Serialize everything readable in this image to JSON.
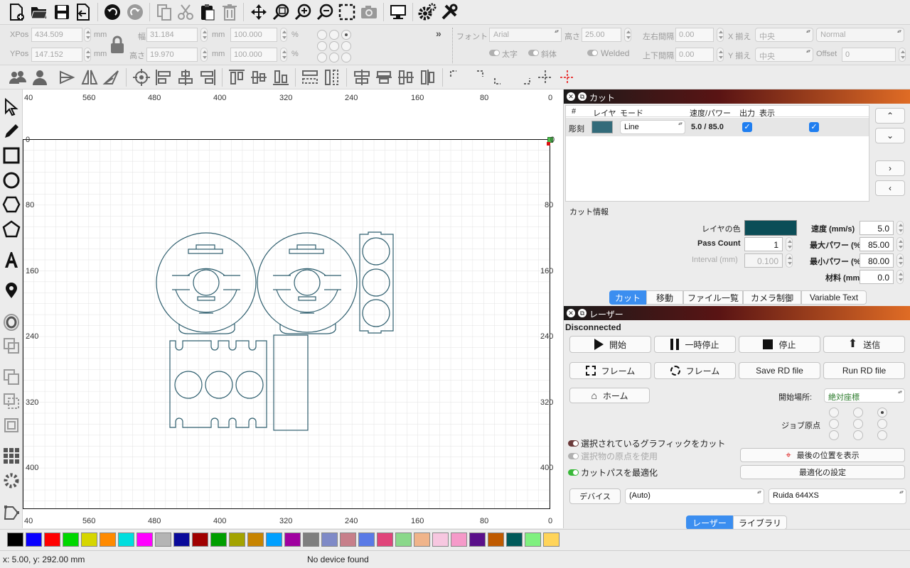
{
  "toolbar1": {
    "icons": [
      "new-file-icon",
      "open-folder-icon",
      "save-icon",
      "export-icon",
      "undo-icon",
      "redo-icon",
      "copy-icon",
      "cut-icon",
      "paste-icon",
      "delete-icon",
      "move-icon",
      "zoom-fit-icon",
      "zoom-in-icon",
      "zoom-out-icon",
      "frame-select-icon",
      "camera-icon",
      "monitor-icon",
      "settings-icon",
      "tools-icon"
    ]
  },
  "props": {
    "xpos_label": "XPos",
    "xpos": "434.509",
    "ypos_label": "YPos",
    "ypos": "147.152",
    "unit": "mm",
    "width_label": "幅",
    "width": "31.184",
    "height_label": "高さ",
    "height": "19.970",
    "scale_x": "100.000",
    "scale_y": "100.000",
    "percent": "%",
    "font_label": "フォント",
    "font": "Arial",
    "font_height_label": "高さ",
    "font_height": "25.00",
    "hspace_label": "左右間隔",
    "hspace": "0.00",
    "vspace_label": "上下間隔",
    "vspace": "0.00",
    "xalign_label": "X 揃え",
    "xalign": "中央",
    "yalign_label": "Y 揃え",
    "yalign": "中央",
    "style": "Normal",
    "offset_label": "Offset",
    "offset": "0",
    "bold": "太字",
    "italic": "斜体",
    "welded": "Welded",
    "more": "»"
  },
  "ruler": {
    "top": [
      "40",
      "560",
      "480",
      "400",
      "320",
      "240",
      "160",
      "80",
      "0"
    ],
    "bottom": [
      "40",
      "560",
      "480",
      "400",
      "320",
      "240",
      "160",
      "80",
      "0"
    ],
    "left": [
      "0",
      "80",
      "160",
      "240",
      "320",
      "400"
    ],
    "right": [
      "0",
      "80",
      "160",
      "240",
      "320",
      "400"
    ]
  },
  "cut_panel": {
    "title": "カット",
    "headers": [
      "#",
      "レイヤ",
      "モード",
      "速度/パワー",
      "出力",
      "表示"
    ],
    "row": {
      "name": "彫刻",
      "color": "#336b7a",
      "mode": "Line",
      "speed_power": "5.0 / 85.0"
    },
    "info_title": "カット情報",
    "layer_color_label": "レイヤの色",
    "layer_color": "#0b4d57",
    "pass_count_label": "Pass Count",
    "pass_count": "1",
    "interval_label": "Interval (mm)",
    "interval": "0.100",
    "speed_label": "速度 (mm/s)",
    "speed": "5.0",
    "max_power_label": "最大パワー (%)",
    "max_power": "85.00",
    "min_power_label": "最小パワー (%)",
    "min_power": "80.00",
    "material_label": "材料 (mm)",
    "material": "0.0",
    "tabs": [
      "カット",
      "移動",
      "ファイル一覧",
      "カメラ制御",
      "Variable Text"
    ]
  },
  "laser_panel": {
    "title": "レーザー",
    "status": "Disconnected",
    "start": "開始",
    "pause": "一時停止",
    "stop": "停止",
    "send": "送信",
    "frame1": "フレーム",
    "frame2": "フレーム",
    "save_rd": "Save RD file",
    "run_rd": "Run RD file",
    "home": "ホーム",
    "start_from_label": "開始場所:",
    "start_from": "絶対座標",
    "job_origin": "ジョブ原点",
    "cut_selected": "選択されているグラフィックをカット",
    "use_origin": "選択物の原点を使用",
    "optimize": "カットパスを最適化",
    "show_last": "最後の位置を表示",
    "optimize_settings": "最適化の設定",
    "device_btn": "デバイス",
    "device": "(Auto)",
    "controller": "Ruida 644XS",
    "tabs": [
      "レーザー",
      "ライブラリ"
    ]
  },
  "palette": [
    "#000000",
    "#0a00ff",
    "#ff0000",
    "#00d800",
    "#d6d600",
    "#ff8a00",
    "#00dede",
    "#ff00ff",
    "#b4b4b4",
    "#0a0a9a",
    "#a00000",
    "#009e00",
    "#a3a300",
    "#c78400",
    "#00a0ff",
    "#a000a0",
    "#7f7f7f",
    "#7f8ac7",
    "#c77f8a",
    "#5a7ae6",
    "#e0447a",
    "#8ad88a",
    "#f0b48a",
    "#f7c7e0",
    "#f59ac9",
    "#5a0f8a",
    "#bf5a00",
    "#005a5a",
    "#7ff07f",
    "#ffd45a"
  ],
  "status": {
    "coords": "x: 5.00, y: 292.00 mm",
    "device": "No device found"
  }
}
